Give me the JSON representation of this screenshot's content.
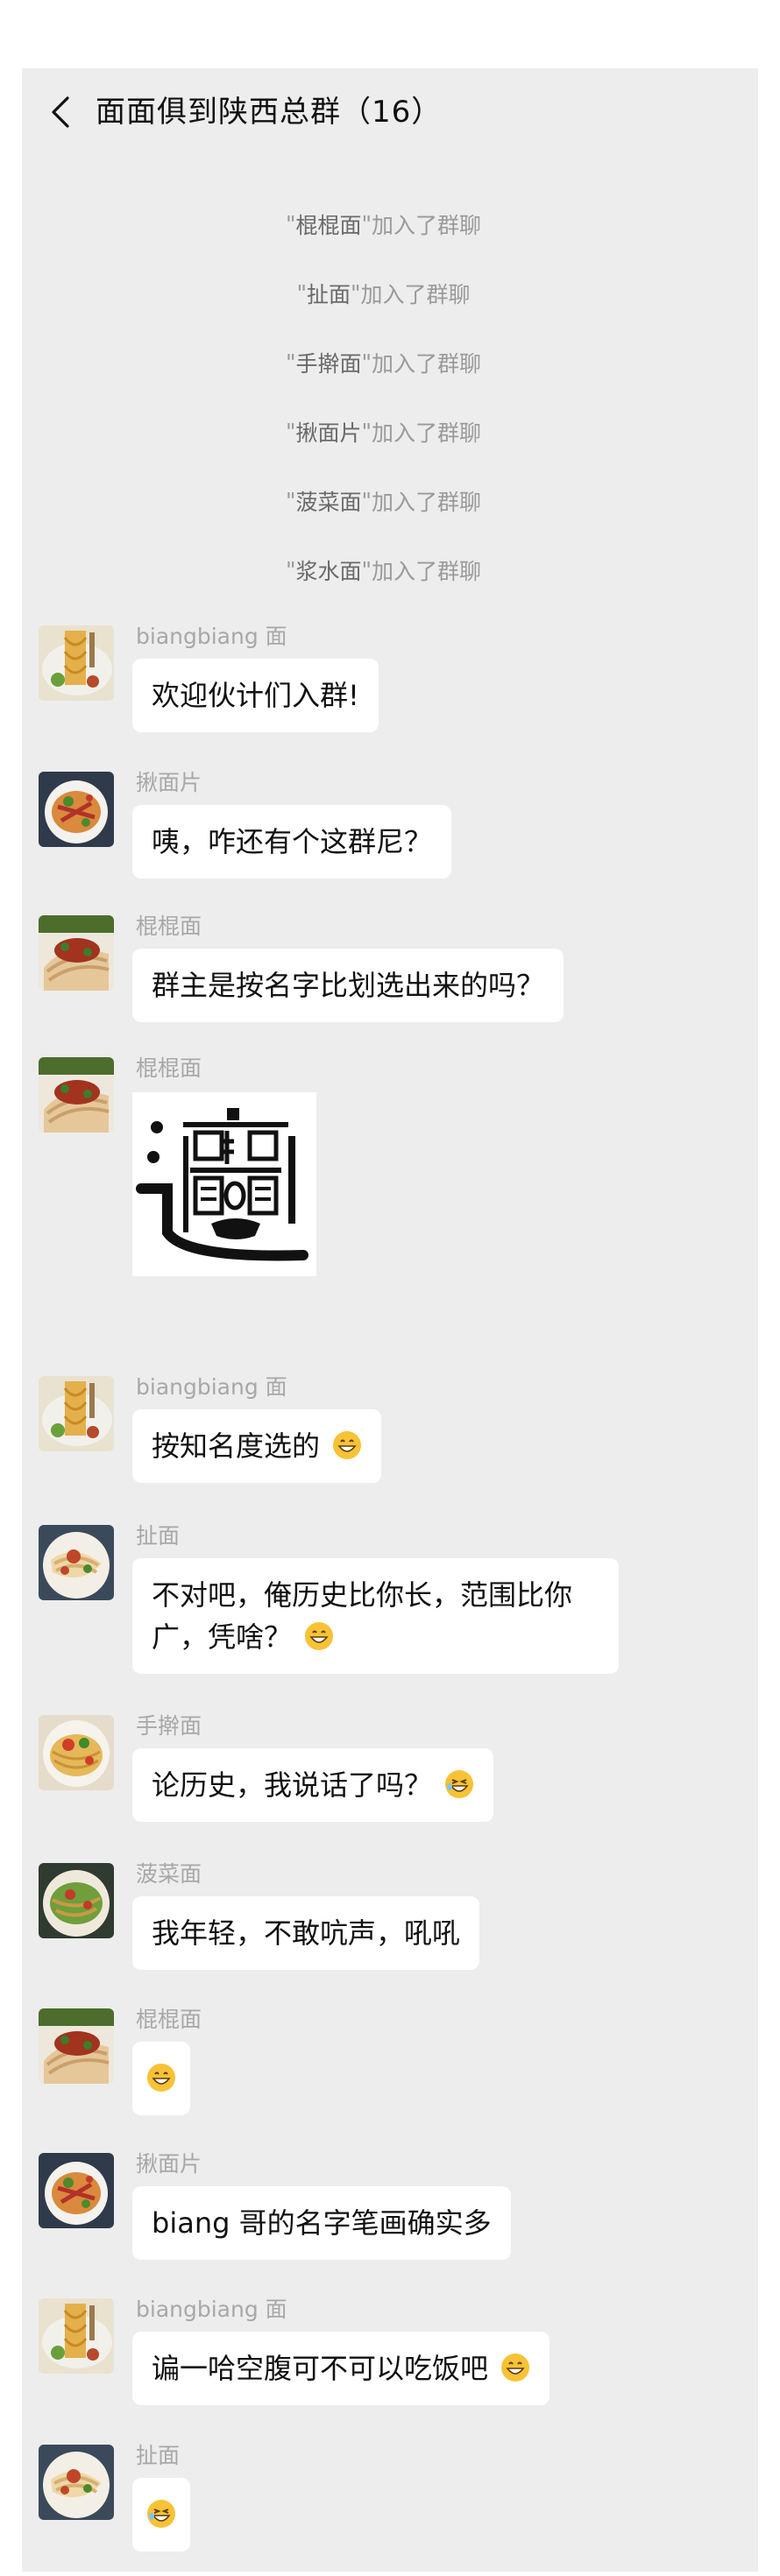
{
  "header": {
    "title": "面面俱到陕西总群（16）"
  },
  "system_messages": [
    {
      "name": "棍棍面",
      "text": "加入了群聊"
    },
    {
      "name": "扯面",
      "text": "加入了群聊"
    },
    {
      "name": "手擀面",
      "text": "加入了群聊"
    },
    {
      "name": "揪面片",
      "text": "加入了群聊"
    },
    {
      "name": "菠菜面",
      "text": "加入了群聊"
    },
    {
      "name": "浆水面",
      "text": "加入了群聊"
    }
  ],
  "messages": [
    {
      "sender": "biangbiang 面",
      "text": "欢迎伙计们入群!",
      "avatar": "biangbiang-noodle-avatar"
    },
    {
      "sender": "揪面片",
      "text": "咦，咋还有个这群尼？",
      "avatar": "jiumianpian-avatar"
    },
    {
      "sender": "棍棍面",
      "text": "群主是按名字比划选出来的吗？",
      "avatar": "gungunmian-avatar"
    },
    {
      "sender": "棍棍面",
      "text": "",
      "avatar": "gungunmian-avatar",
      "image": "biang-character-image"
    },
    {
      "sender": "biangbiang 面",
      "text": "按知名度选的",
      "emoji": "grinning-face-icon",
      "avatar": "biangbiang-noodle-avatar"
    },
    {
      "sender": "扯面",
      "text": "不对吧，俺历史比你长，范围比你广，凭啥？",
      "emoji": "grinning-face-icon",
      "avatar": "chemian-avatar"
    },
    {
      "sender": "手擀面",
      "text": "论历史，我说话了吗？",
      "emoji": "laughing-face-icon",
      "avatar": "shouganmian-avatar"
    },
    {
      "sender": "菠菜面",
      "text": "我年轻，不敢吭声，吼吼",
      "avatar": "bocaimian-avatar"
    },
    {
      "sender": "棍棍面",
      "text": "",
      "emoji": "grinning-face-icon",
      "avatar": "gungunmian-avatar"
    },
    {
      "sender": "揪面片",
      "text": "biang 哥的名字笔画确实多",
      "avatar": "jiumianpian-avatar"
    },
    {
      "sender": "biangbiang 面",
      "text": "谝一哈空腹可不可以吃饭吧",
      "emoji": "grinning-face-icon",
      "avatar": "biangbiang-noodle-avatar"
    },
    {
      "sender": "扯面",
      "text": "",
      "emoji": "laughing-face-icon",
      "avatar": "chemian-avatar"
    }
  ],
  "colors": {
    "background": "#ededed",
    "bubble": "#ffffff",
    "system_text": "#9a9a9a",
    "sender_text": "#a8a8a8"
  }
}
